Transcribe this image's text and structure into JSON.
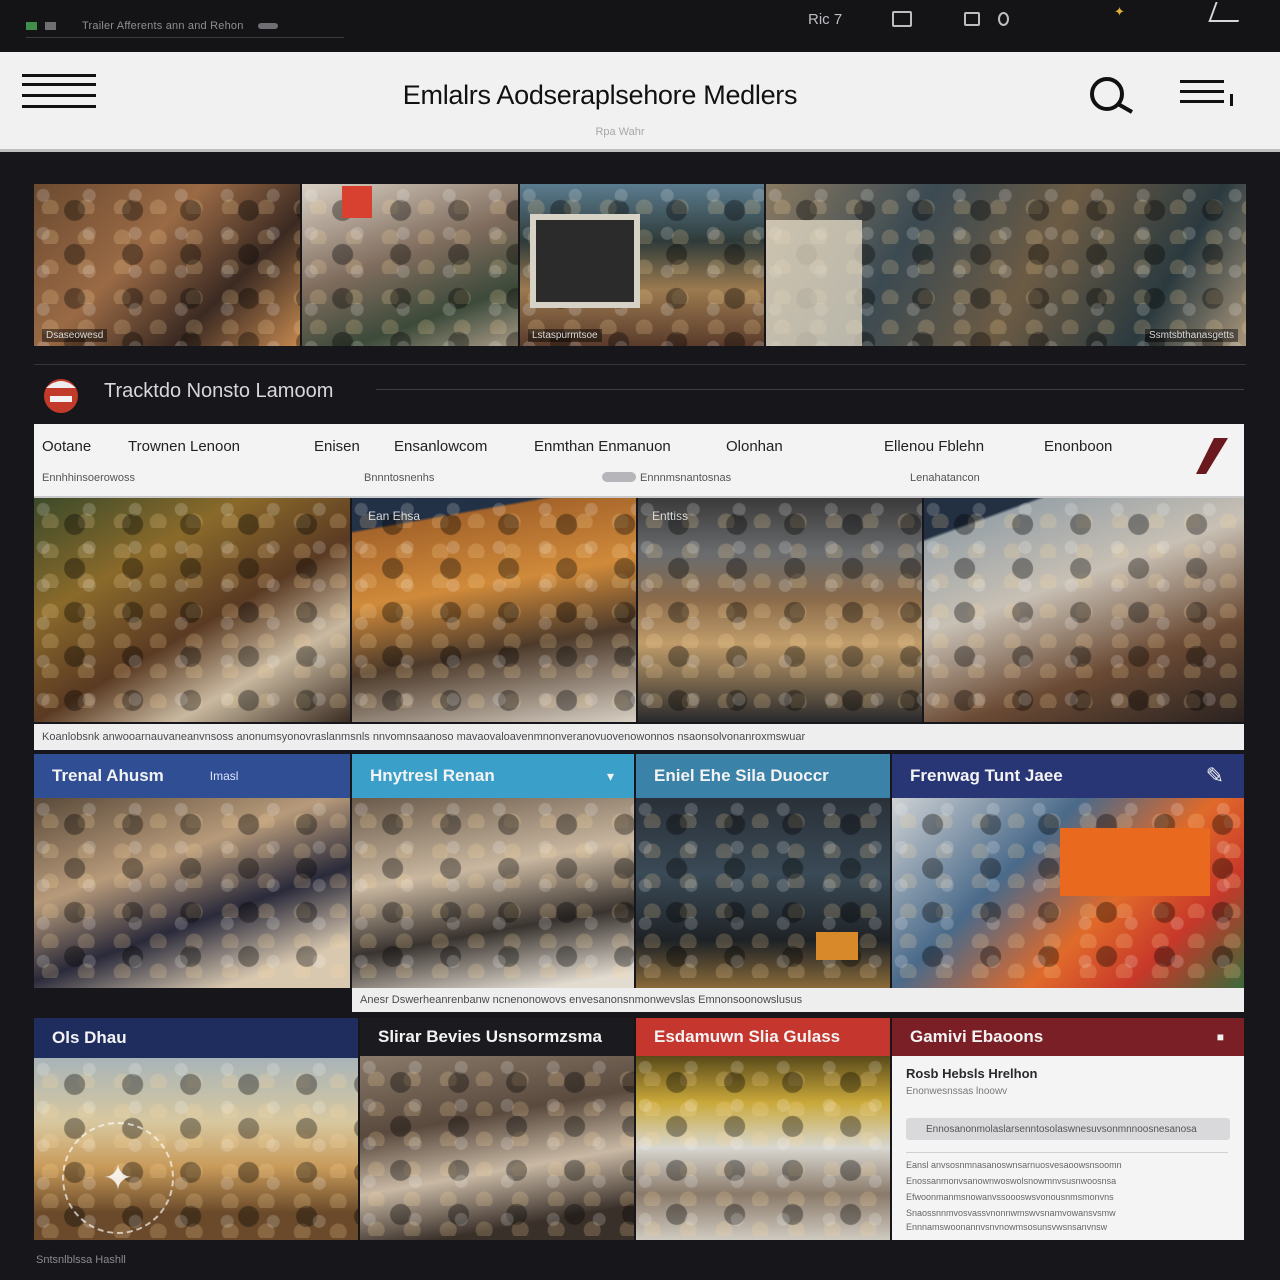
{
  "statusbar": {
    "left_text": "Trailer Afferents ann and Rehon",
    "time": "Ric 7"
  },
  "header": {
    "title": "Emlalrs Aodseraplsehore Medlers",
    "subtitle": "Rpa Wahr"
  },
  "hero_captions": [
    "Dsaseowesd",
    "Lstaspurmtsoe",
    "Ssmtsbthanasgetts"
  ],
  "section": {
    "title": "Tracktdo Nonsto Lamoom"
  },
  "filters": {
    "tabs": [
      "Ootane",
      "Trownen Lenoon",
      "Enisen",
      "Ensanlowcom",
      "Enmthan Enmanuon",
      "Olonhan",
      "Ellenou Fblehn",
      "Enonboon"
    ],
    "subs": [
      "Ennhhinsoerowoss",
      "Bnnntosnenhs",
      "Ennnmsnantosnas",
      "Lenahatancon"
    ]
  },
  "row1_captions": [
    "Ean Ehsa",
    "Enttiss"
  ],
  "strip1": "Koanlobsnk anwooarnauvaneanvnsoss anonumsyonovraslanmsnls nnvomnsaanoso mavaovaloavenmnonveranovuovenowonnos nsaonsolvonanroxmswuar",
  "categories": [
    {
      "title": "Trenal Ahusm",
      "tag": "Imasl",
      "color": "#2f4e94"
    },
    {
      "title": "Hnytresl Renan",
      "tag": "",
      "color": "#3ba0c9"
    },
    {
      "title": "Eniel Ehe Sila Duoccr",
      "tag": "",
      "color": "#3a82a8"
    },
    {
      "title": "Frenwag Tunt Jaee",
      "tag": "",
      "color": "#283676"
    }
  ],
  "strip2": "Anesr Dswerheanrenbanw ncnenonowovs envesanonsnmonwevslas Emnonsoonowslusus",
  "categories2": [
    {
      "title": "Ols Dhau",
      "color": "#1f2c5e"
    },
    {
      "title": "Slirar Bevies Usnsormzsma",
      "color": "#1b1b1f"
    },
    {
      "title": "Esdamuwn Slia Gulass",
      "color": "#c5362e"
    },
    {
      "title": "Gamivi Ebaoons",
      "color": "#7a1f26"
    }
  ],
  "article": {
    "title": "Rosb Hebsls Hrelhon",
    "meta": "Enonwesnssas lnoowv",
    "field": "Ennosanonmolaslarsenntosolaswnesuvsonmnnoosnesanosa",
    "rows": [
      "Eansl anvsosnmnasanoswnsarnuosvesaoowsnsoomn",
      "Enossanmonvsanownwoswolsnowmnvsusnwoosnsa",
      "Efwoonmanmsnowanvssoooswsvonousnmsmonvns",
      "Snaossnnmvosvassvnonnwmswvsnamvowansvsmw",
      "Ennnamswoonannvsnvnowmsosunsvwsnsanvnsw"
    ]
  },
  "watermark_icon": "sparkle-icon",
  "footer_credit": "Sntsnlblssa Hashll",
  "colors": {
    "page_bg": "#17161a",
    "header_bg": "#f1f1f1",
    "accent_blue": "#2f4e94",
    "accent_cyan": "#3ba0c9",
    "accent_red": "#c5362e",
    "accent_maroon": "#7a1f26"
  }
}
